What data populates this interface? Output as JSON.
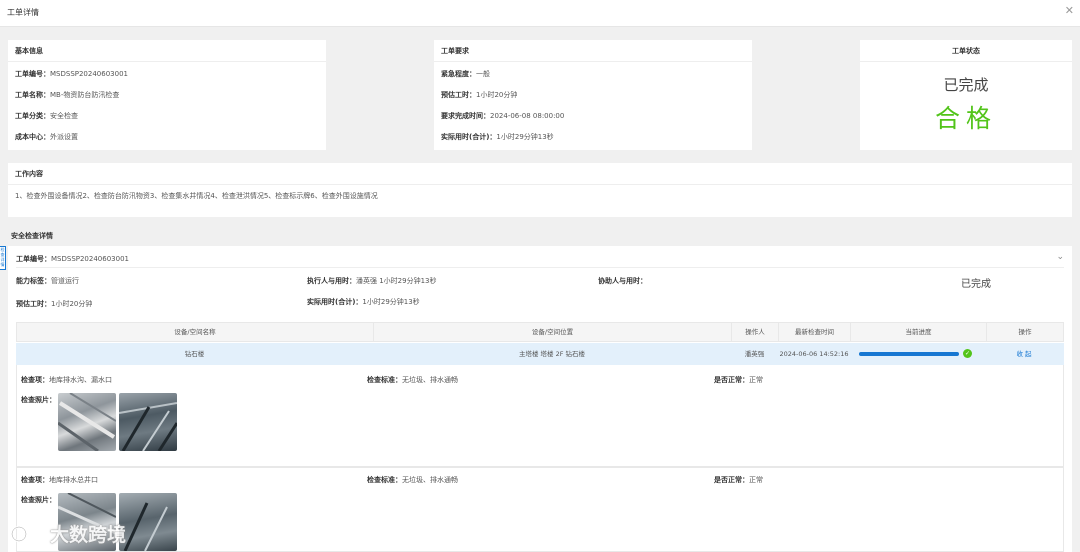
{
  "window": {
    "title": "工单详情",
    "close_icon": "close-icon"
  },
  "basic_info": {
    "heading": "基本信息",
    "fields": [
      {
        "label": "工单编号：",
        "value": "MSDSSP20240603001"
      },
      {
        "label": "工单名称：",
        "value": "MB-物资防台防汛检查"
      },
      {
        "label": "工单分类：",
        "value": "安全检查"
      },
      {
        "label": "成本中心：",
        "value": "外派设置"
      }
    ]
  },
  "requirements": {
    "heading": "工单要求",
    "fields": [
      {
        "label": "紧急程度：",
        "value": "一般"
      },
      {
        "label": "预估工时：",
        "value": "1小时20分钟"
      },
      {
        "label": "要求完成时间：",
        "value": "2024-06-08 08:00:00"
      },
      {
        "label": "实际用时(合计)：",
        "value": "1小时29分钟13秒"
      }
    ]
  },
  "status": {
    "heading": "工单状态",
    "state": "已完成",
    "result": "合格",
    "result_color": "#52c41a"
  },
  "content": {
    "heading": "工作内容",
    "text": "1、检查外围设备情况2、检查防台防汛物资3、检查集水井情况4、检查泄洪情况5、检查标示牌6、检查外围设施情况"
  },
  "safety_detail": {
    "heading": "安全检查详情",
    "order_no_label": "工单编号：",
    "order_no": "MSDSSP20240603001",
    "state": "已完成",
    "fields": {
      "skill_label": "能力标签：",
      "skill": "管道运行",
      "executor_label": "执行人与用时：",
      "executor": "潘英强   1小时29分钟13秒",
      "assistant_label": "协助人与用时：",
      "assistant": "",
      "estimate_label": "预估工时：",
      "estimate": "1小时20分钟",
      "actual_label": "实际用时(合计)：",
      "actual": "1小时29分钟13秒"
    },
    "table": {
      "headers": [
        "设备/空间名称",
        "设备/空间位置",
        "操作人",
        "最新检查时间",
        "当前进度",
        "操作"
      ],
      "row": {
        "name": "钻石楼",
        "location": "主塔楼 塔楼 2F 钻石楼",
        "operator": "潘英强",
        "time": "2024-06-06 14:52:16",
        "progress": 1.0,
        "action": "收 起"
      }
    },
    "items": [
      {
        "item_label": "检查项：",
        "item": "地库排水沟、漏水口",
        "standard_label": "检查标准：",
        "standard": "无垃圾、排水通畅",
        "normal_label": "是否正常：",
        "normal": "正常",
        "photos_label": "检查照片："
      },
      {
        "item_label": "检查项：",
        "item": "地库排水总井口",
        "standard_label": "检查标准：",
        "standard": "无垃圾、排水通畅",
        "normal_label": "是否正常：",
        "normal": "正常",
        "photos_label": "检查照片："
      }
    ],
    "side_tab": "检查详情"
  },
  "watermark": {
    "text": "大数跨境"
  }
}
